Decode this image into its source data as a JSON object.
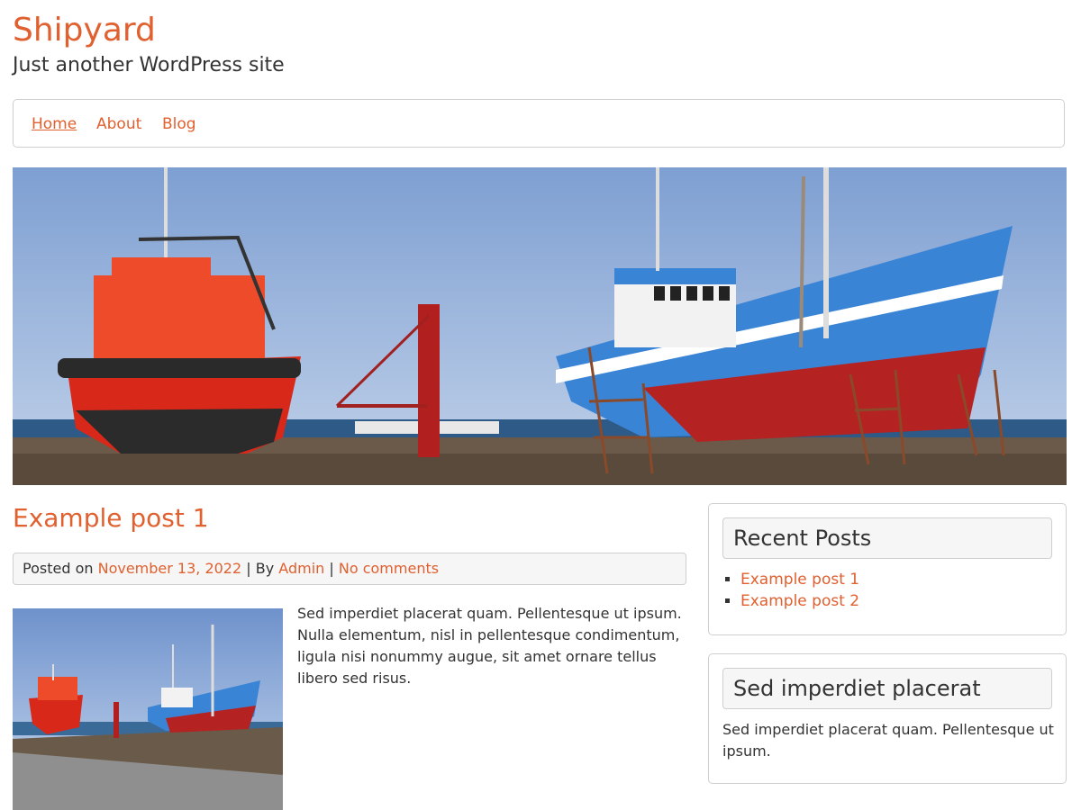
{
  "site": {
    "title": "Shipyard",
    "description": "Just another WordPress site",
    "accent_color": "#e0602f"
  },
  "nav": {
    "items": [
      {
        "label": "Home",
        "current": true
      },
      {
        "label": "About"
      },
      {
        "label": "Blog"
      }
    ]
  },
  "hero": {
    "image_description": ""
  },
  "post": {
    "title": "Example post 1",
    "meta": {
      "posted_on_label": "Posted on",
      "date": "November 13, 2022",
      "separator": "|",
      "by_label": "By",
      "author": "Admin",
      "comments": "No comments"
    },
    "excerpt": "Sed imperdiet placerat quam. Pellentesque ut ipsum. Nulla elementum, nisl in pellentesque condimentum, ligula nisi nonummy augue, sit amet ornare tellus libero sed risus."
  },
  "sidebar": {
    "recent_posts": {
      "title": "Recent Posts",
      "items": [
        "Example post 1",
        "Example post 2"
      ]
    },
    "text_widget": {
      "title": "Sed imperdiet placerat",
      "body": "Sed imperdiet placerat quam. Pellentesque ut ipsum."
    }
  }
}
